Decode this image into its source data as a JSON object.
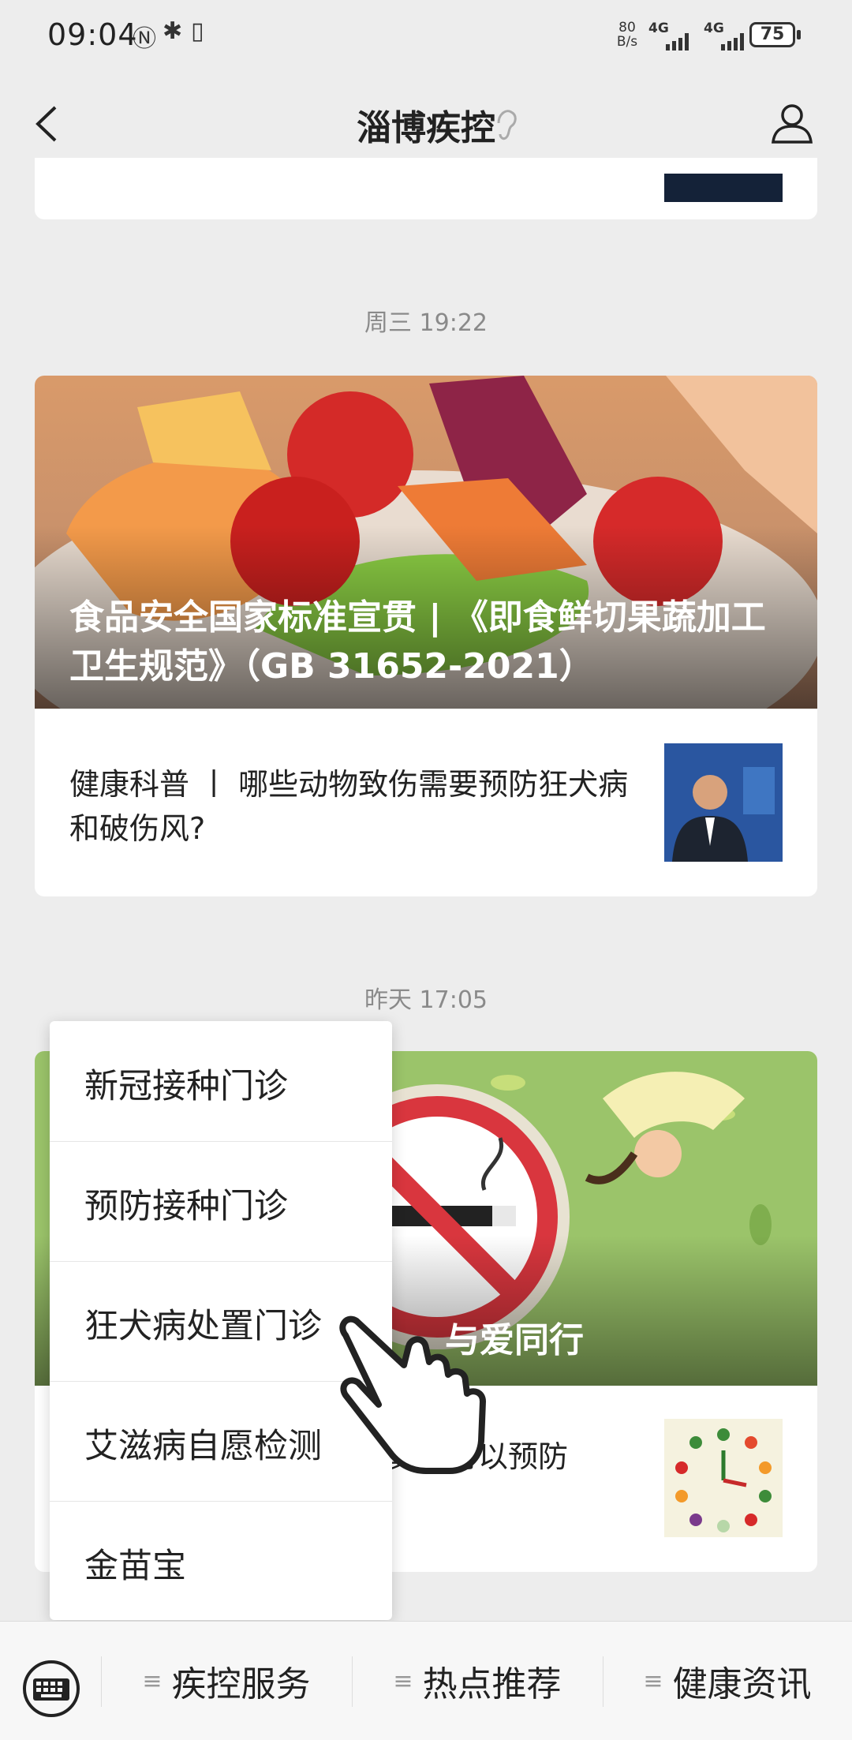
{
  "status_bar": {
    "time": "09:04",
    "net_speed_top": "80",
    "net_speed_bottom": "B/s",
    "sig1": "4G",
    "sig2": "4G",
    "battery": "75"
  },
  "header": {
    "title": "淄博疾控",
    "back_icon": "chevron-left-icon",
    "ear_icon": "ear-icon",
    "profile_icon": "person-icon"
  },
  "messages": [
    {
      "time": "周三 19:22",
      "hero_title_line1": "食品安全国家标准宣贯 | 《即食鲜切果蔬加工",
      "hero_title_line2": "卫生规范》（GB 31652-2021）",
      "item_line1": "健康科普 丨 哪些动物致伤需要预防狂犬病",
      "item_line2": "和破伤风?"
    },
    {
      "time": "昨天 17:05",
      "hero_title_partial": "与爱同行",
      "item_partial": "真的可以预防"
    }
  ],
  "popup_menu": {
    "items": [
      "新冠接种门诊",
      "预防接种门诊",
      "狂犬病处置门诊",
      "艾滋病自愿检测",
      "金苗宝"
    ]
  },
  "bottom_bar": {
    "keyboard_icon": "keyboard-icon",
    "tabs": [
      "疾控服务",
      "热点推荐",
      "健康资讯"
    ]
  },
  "colors": {
    "background": "#ededed",
    "card": "#ffffff",
    "no_smoking_red": "#d9363e",
    "poster_green": "#9bc46a"
  }
}
